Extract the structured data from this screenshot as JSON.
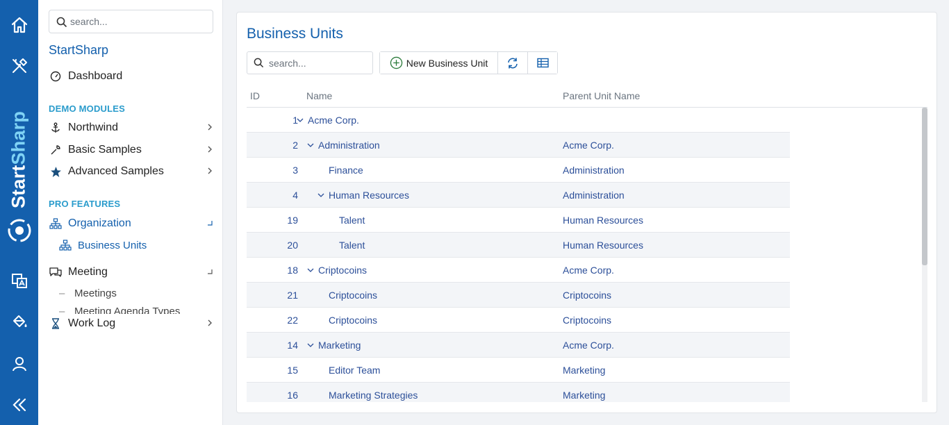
{
  "rail": {
    "brand_part1": "Start",
    "brand_part2": "Sharp",
    "icons": [
      "home-icon",
      "tools-icon",
      "translate-icon",
      "paint-bucket-icon",
      "user-icon",
      "collapse-icon"
    ]
  },
  "sidebar": {
    "search_placeholder": "search...",
    "app_title": "StartSharp",
    "dashboard": "Dashboard",
    "demo_section": "DEMO MODULES",
    "northwind": "Northwind",
    "basic_samples": "Basic Samples",
    "advanced_samples": "Advanced Samples",
    "pro_section": "PRO FEATURES",
    "organization": "Organization",
    "business_units": "Business Units",
    "meeting": "Meeting",
    "meetings": "Meetings",
    "meeting_agenda_types": "Meeting Agenda Types",
    "work_log": "Work Log"
  },
  "main": {
    "title": "Business Units",
    "search_placeholder": "search...",
    "new_button": "New Business Unit",
    "columns": {
      "id": "ID",
      "name": "Name",
      "parent": "Parent Unit Name"
    },
    "rows": [
      {
        "id": "1",
        "name": "Acme Corp.",
        "parent": "",
        "level": 0,
        "expandable": true
      },
      {
        "id": "2",
        "name": "Administration",
        "parent": "Acme Corp.",
        "level": 1,
        "expandable": true
      },
      {
        "id": "3",
        "name": "Finance",
        "parent": "Administration",
        "level": 2,
        "expandable": false
      },
      {
        "id": "4",
        "name": "Human Resources",
        "parent": "Administration",
        "level": 2,
        "expandable": true
      },
      {
        "id": "19",
        "name": "Talent",
        "parent": "Human Resources",
        "level": 3,
        "expandable": false
      },
      {
        "id": "20",
        "name": "Talent",
        "parent": "Human Resources",
        "level": 3,
        "expandable": false
      },
      {
        "id": "18",
        "name": "Criptocoins",
        "parent": "Acme Corp.",
        "level": 1,
        "expandable": true
      },
      {
        "id": "21",
        "name": "Criptocoins",
        "parent": "Criptocoins",
        "level": 2,
        "expandable": false
      },
      {
        "id": "22",
        "name": "Criptocoins",
        "parent": "Criptocoins",
        "level": 2,
        "expandable": false
      },
      {
        "id": "14",
        "name": "Marketing",
        "parent": "Acme Corp.",
        "level": 1,
        "expandable": true
      },
      {
        "id": "15",
        "name": "Editor Team",
        "parent": "Marketing",
        "level": 2,
        "expandable": false
      },
      {
        "id": "16",
        "name": "Marketing Strategies",
        "parent": "Marketing",
        "level": 2,
        "expandable": false
      }
    ]
  },
  "colors": {
    "brand_blue": "#1460ad",
    "accent_cyan": "#2b9ccc",
    "link_blue": "#2c4f99",
    "row_alt": "#f3f5f8"
  }
}
